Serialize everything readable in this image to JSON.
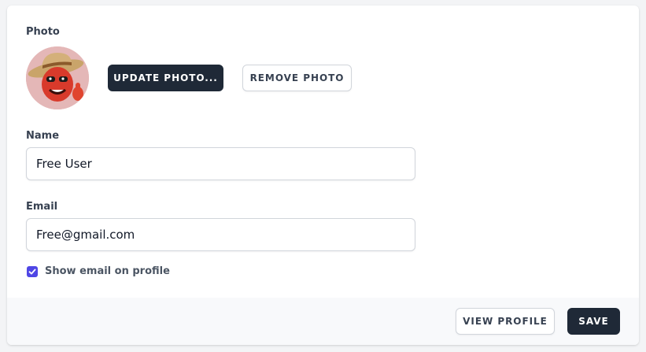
{
  "photo": {
    "label": "Photo",
    "update_button": "UPDATE PHOTO...",
    "remove_button": "REMOVE PHOTO"
  },
  "name": {
    "label": "Name",
    "value": "Free User"
  },
  "email": {
    "label": "Email",
    "value": "Free@gmail.com"
  },
  "show_email": {
    "label": "Show email on profile",
    "checked": true
  },
  "footer": {
    "view_profile_button": "VIEW PROFILE",
    "save_button": "SAVE"
  },
  "colors": {
    "dark_button": "#1f2937",
    "checkbox_accent": "#4f46e5"
  }
}
